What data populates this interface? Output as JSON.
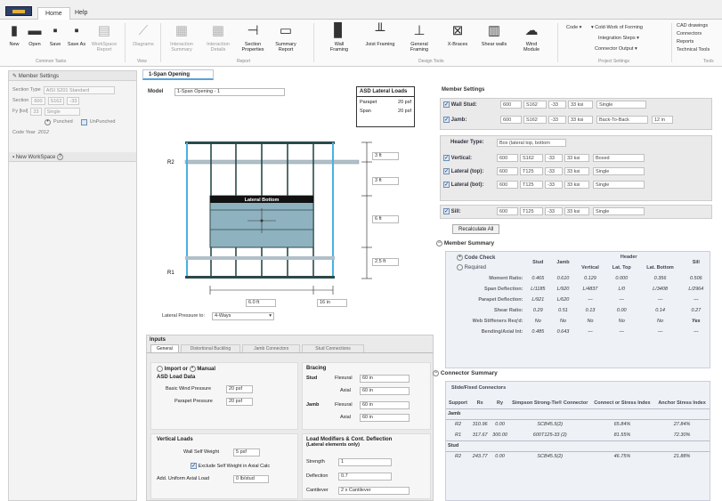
{
  "menu": {
    "tabs": [
      "Home",
      "Help"
    ]
  },
  "ribbon": {
    "buttons": [
      {
        "label": "New"
      },
      {
        "label": "Open"
      },
      {
        "label": "Save"
      },
      {
        "label": "Save As"
      },
      {
        "label": "WorkSpace Report"
      },
      {
        "label": "Diagrams"
      },
      {
        "label": "Interaction Summary"
      },
      {
        "label": "Interaction Details"
      },
      {
        "label": "Section Properties"
      },
      {
        "label": "Summary Report"
      },
      {
        "label": "Wall Framing"
      },
      {
        "label": "Joist Framing"
      },
      {
        "label": "General Framing"
      },
      {
        "label": "X-Braces"
      },
      {
        "label": "Shear walls"
      },
      {
        "label": "Wind Module"
      }
    ],
    "groups": [
      "Common Tasks",
      "View",
      "Report",
      "Design Tools",
      "Project Settings",
      "Tools"
    ],
    "settings": [
      "Code",
      "Cold-Work of Forming",
      "Integration Steps",
      "Connector Output"
    ],
    "tools": [
      "CAD drawings",
      "Connectors",
      "Reports",
      "Technical Tools"
    ]
  },
  "left": {
    "member_settings_title": "Member Settings",
    "section_type_label": "Section Type",
    "section_type": "AISI S201 Standard",
    "section_label": "Section",
    "section_vals": [
      "600",
      "S162",
      "-33"
    ],
    "fy_label": "Fy [ksi]",
    "fy": "33",
    "fy_opt": "Single",
    "punched": "Punched",
    "unpunched": "UnPunched",
    "code_year_label": "Code Year",
    "code_year": "2012",
    "workspace_title": "New WorkSpace"
  },
  "doc": {
    "tab": "1-Span Opening"
  },
  "model": {
    "label": "Model",
    "value": "1-Span Opening - 1"
  },
  "asd": {
    "title": "ASD Lateral Loads",
    "rows": [
      {
        "k": "Parapet",
        "v": "20 psf"
      },
      {
        "k": "Span",
        "v": "20 psf"
      }
    ]
  },
  "elev": {
    "header": "Lateral Bottom",
    "r2": "R2",
    "r1": "R1",
    "dims": [
      "3 ft",
      "3 ft",
      "6 ft",
      "2.5 ft"
    ],
    "bottom_dims": [
      "6.0 ft",
      "16 in"
    ],
    "pressure_label": "Lateral Pressure to:",
    "pressure_value": "4-Ways"
  },
  "inputs": {
    "title": "Inputs",
    "tabs": [
      "General",
      "Distortional Buckling",
      "Jamb Connectors",
      "Stud Connections"
    ],
    "import_label": "Import or",
    "manual_label": "Manual",
    "asd_title": "ASD Load Data",
    "basic_wind_label": "Basic Wind Pressure",
    "basic_wind": "20 psf",
    "parapet_label": "Parapet Pressure",
    "parapet": "20 psf",
    "bracing_title": "Bracing",
    "stud": "Stud",
    "jamb": "Jamb",
    "flexural": "Flexural",
    "axial": "Axial",
    "brace_vals": [
      "60 in",
      "60 in",
      "60 in",
      "60 in"
    ],
    "vertical_title": "Vertical Loads",
    "self_weight_label": "Wall Self Weight",
    "self_weight": "5 psf",
    "exclude_label": "Exclude Self Weight in Axial Calc",
    "uniform_label": "Add. Uniform Axial Load",
    "uniform": "0 lb/stud",
    "modifiers_title": "Load Modifiers & Cont. Deflection",
    "modifiers_sub": "(Lateral elements only)",
    "strength_label": "Strength",
    "strength": "1",
    "deflection_label": "Deflection",
    "deflection": "0.7",
    "cantilever_label": "Cantilever",
    "cantilever": "2 x Cantilever"
  },
  "member_settings": {
    "title": "Member Settings",
    "wall_stud": {
      "label": "Wall Stud:",
      "vals": [
        "600",
        "S162",
        "-33",
        "33 ksi",
        "Single"
      ]
    },
    "jamb": {
      "label": "Jamb:",
      "vals": [
        "600",
        "S162",
        "-33",
        "33 ksi",
        "Back-To-Back",
        "12 in"
      ]
    },
    "header_type_label": "Header Type:",
    "header_type": "Box (lateral top, bottom",
    "vertical": {
      "label": "Vertical:",
      "vals": [
        "600",
        "S162",
        "-33",
        "33 ksi",
        "Boxed"
      ]
    },
    "lat_top": {
      "label": "Lateral (top):",
      "vals": [
        "600",
        "T125",
        "-33",
        "33 ksi",
        "Single"
      ]
    },
    "lat_bot": {
      "label": "Lateral (bot):",
      "vals": [
        "600",
        "T125",
        "-33",
        "33 ksi",
        "Single"
      ]
    },
    "sill": {
      "label": "Sill:",
      "vals": [
        "600",
        "T125",
        "-33",
        "33 ksi",
        "Single"
      ]
    },
    "recalc": "Recalculate All"
  },
  "summary": {
    "title": "Member Summary",
    "code_check": "Code Check",
    "required": "Required",
    "header_group": "Header",
    "cols": [
      "Stud",
      "Jamb",
      "Vertical",
      "Lat. Top",
      "Lat. Bottom",
      "Sill"
    ],
    "rows": [
      {
        "label": "Moment Ratio:",
        "vals": [
          "0.465",
          "0.610",
          "0.129",
          "0.000",
          "0.356",
          "0.506"
        ]
      },
      {
        "label": "Span Deflection:",
        "vals": [
          "L/1185",
          "L/920",
          "L/4837",
          "L/0",
          "L/3408",
          "L/2964"
        ]
      },
      {
        "label": "Parapet Deflection:",
        "vals": [
          "L/921",
          "L/620",
          "---",
          "---",
          "---",
          "---"
        ]
      },
      {
        "label": "Shear Ratio:",
        "vals": [
          "0.29",
          "0.51",
          "0.13",
          "0.00",
          "0.14",
          "0.27"
        ]
      },
      {
        "label": "Web Stiffeners Req'd:",
        "vals": [
          "No",
          "No",
          "No",
          "No",
          "No",
          "Yes"
        ]
      },
      {
        "label": "Bending/Axial Int:",
        "vals": [
          "0.485",
          "0.643",
          "---",
          "---",
          "---",
          "---"
        ]
      }
    ]
  },
  "connectors": {
    "title": "Connector Summary",
    "sub": "Slide/Fixed Connectors",
    "cols": [
      "Support",
      "Rx",
      "Ry",
      "Simpson Strong-Tie® Connector",
      "Connect or Stress Index",
      "Anchor Stress Index"
    ],
    "groups": [
      {
        "name": "Jamb",
        "rows": [
          [
            "R2",
            "310.96",
            "0.00",
            "SCB45.5(2)",
            "65.84%",
            "27.84%"
          ],
          [
            "R1",
            "317.67",
            "300.00",
            "600T125-33 (2)",
            "81.55%",
            "72.30%"
          ]
        ]
      },
      {
        "name": "Stud",
        "rows": [
          [
            "R2",
            "243.77",
            "0.00",
            "SCB45.5(2)",
            "46.75%",
            "21.88%"
          ]
        ]
      }
    ]
  }
}
